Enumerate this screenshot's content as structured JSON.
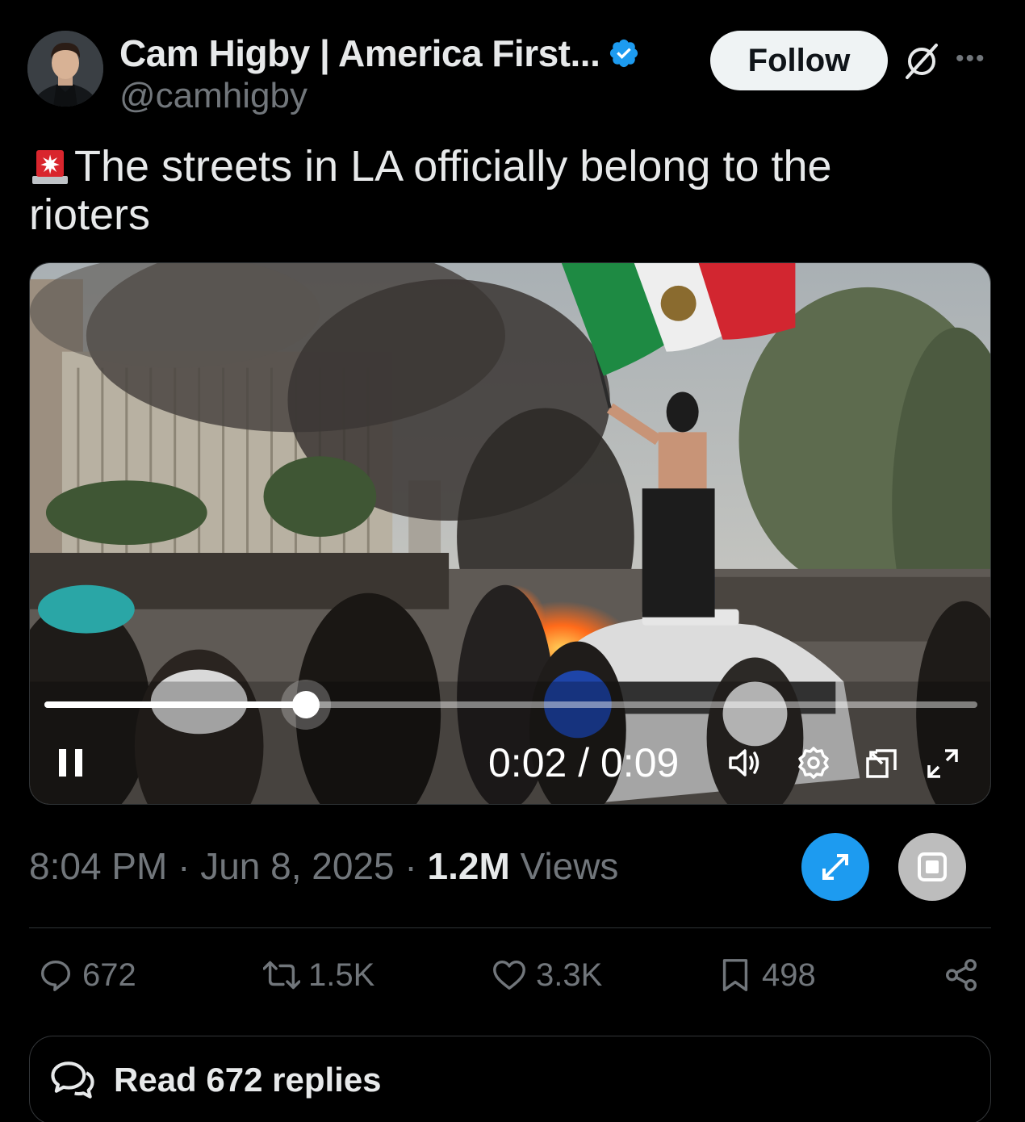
{
  "author": {
    "display_name": "Cam Higby | America First...",
    "handle": "@camhigby",
    "verified": true,
    "avatar_icon": "profile-photo"
  },
  "header": {
    "follow_label": "Follow",
    "grok_icon": "grok-icon",
    "more_icon": "more-options-icon"
  },
  "tweet": {
    "emoji": "police-siren-icon",
    "text": "The streets in LA officially belong to the rioters"
  },
  "video": {
    "time_label": "0:02 / 0:09",
    "progress": 0.28,
    "controls": [
      "pause-icon",
      "volume-icon",
      "settings-gear-icon",
      "picture-in-picture-icon",
      "fullscreen-expand-icon"
    ]
  },
  "meta": {
    "time": "8:04 PM",
    "separator": "·",
    "date": "Jun 8, 2025",
    "views_count": "1.2M",
    "views_label": "Views"
  },
  "actions": {
    "replies": "672",
    "reposts": "1.5K",
    "likes": "3.3K",
    "bookmarks": "498"
  },
  "read_replies_label": "Read 672 replies",
  "colors": {
    "background": "#000000",
    "text_primary": "#e7e9ea",
    "text_secondary": "#71767b",
    "accent_blue": "#1d9bf0",
    "divider": "#2f3336"
  }
}
